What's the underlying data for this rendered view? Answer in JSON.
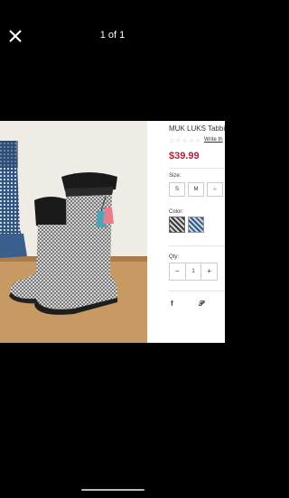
{
  "viewer": {
    "counter": "1 of 1"
  },
  "product": {
    "title": "MUK LUKS Tabbi",
    "rating": "☆☆☆☆☆",
    "write_review": "Write th",
    "price": "$39.99",
    "size_label": "Size:",
    "sizes": [
      "S",
      "M",
      "L"
    ],
    "color_label": "Color:",
    "colors": [
      "#3a3a3a",
      "#2f5a8a"
    ],
    "qty_label": "Qty:",
    "qty_minus": "−",
    "qty_value": "1",
    "qty_plus": "+",
    "share_icons": [
      "facebook-icon",
      "pinterest-icon"
    ]
  }
}
